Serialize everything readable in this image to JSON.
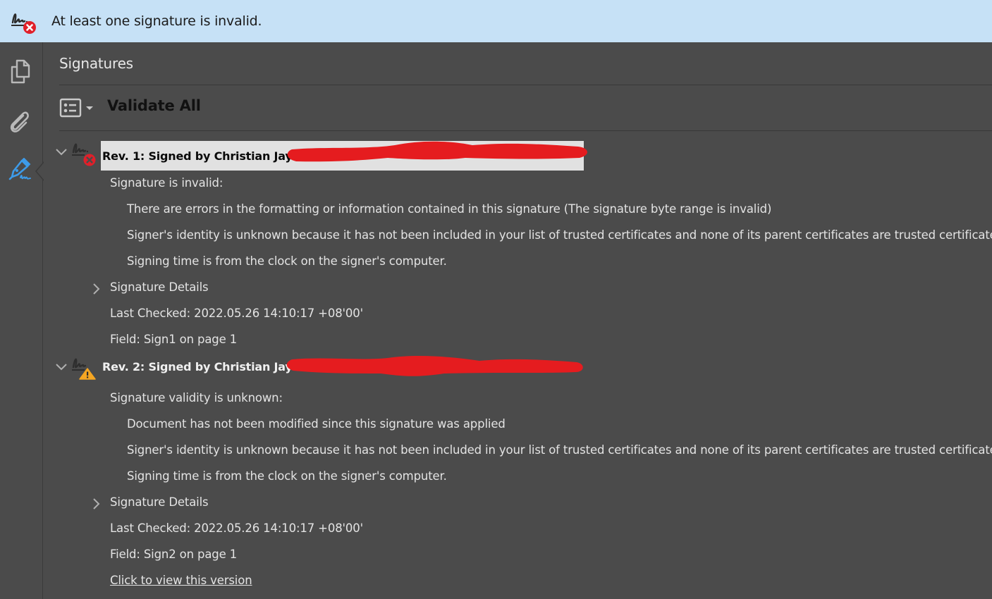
{
  "banner": {
    "icon": "signature-invalid-icon",
    "message": "At least one signature is invalid.",
    "background": "#c6e1f6"
  },
  "left_rail": {
    "items": [
      {
        "name": "page-thumbnails",
        "icon": "pages-icon",
        "active": false
      },
      {
        "name": "attachments",
        "icon": "paperclip-icon",
        "active": false
      },
      {
        "name": "signatures",
        "icon": "signature-pen-icon",
        "active": true
      }
    ],
    "active_color": "#3d9be9"
  },
  "panel": {
    "title": "Signatures",
    "toolbar": {
      "options_icon": "options-list-icon",
      "validate_all_label": "Validate All"
    }
  },
  "signatures": [
    {
      "header": "Rev. 1: Signed by Christian Jay",
      "status": "invalid",
      "status_icon": "error-x-icon",
      "redacted": true,
      "selected": true,
      "summary": "Signature is invalid:",
      "reasons": [
        "There are errors in the formatting or information contained in this signature (The signature byte range is invalid)",
        "Signer's identity is unknown because it has not been included in your list of trusted certificates and none of its parent certificates are trusted certificates",
        "Signing time is from the clock on the signer's computer."
      ],
      "details_label": "Signature Details",
      "last_checked": "Last Checked: 2022.05.26 14:10:17 +08'00'",
      "field": "Field: Sign1 on page 1"
    },
    {
      "header": "Rev. 2: Signed by Christian Jay",
      "status": "unknown",
      "status_icon": "warning-triangle-icon",
      "redacted": true,
      "selected": false,
      "summary": "Signature validity is unknown:",
      "reasons": [
        "Document has not been modified since this signature was applied",
        "Signer's identity is unknown because it has not been included in your list of trusted certificates and none of its parent certificates are trusted certificates",
        "Signing time is from the clock on the signer's computer."
      ],
      "details_label": "Signature Details",
      "last_checked": "Last Checked: 2022.05.26 14:10:17 +08'00'",
      "field": "Field: Sign2 on page 1",
      "view_version_link": "Click to view this version"
    }
  ],
  "colors": {
    "error_red": "#e0202a",
    "warning_amber": "#f5a623",
    "redaction_red": "#e51c1f",
    "panel_bg": "#4b4b4b"
  }
}
